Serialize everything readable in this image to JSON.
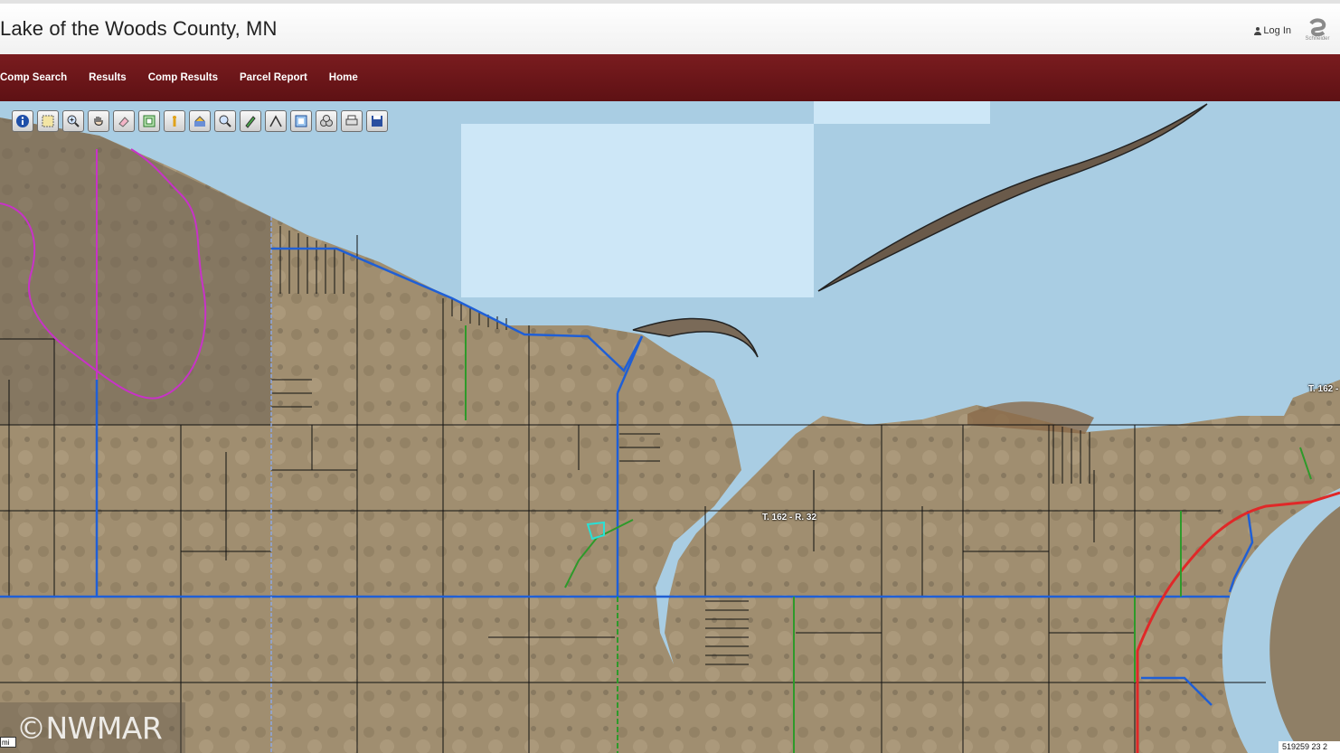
{
  "header": {
    "title": "Lake of the Woods County, MN",
    "login_label": "Log In",
    "brand_text": "Schneider"
  },
  "nav": {
    "items": [
      "Comp Search",
      "Results",
      "Comp Results",
      "Parcel Report",
      "Home"
    ]
  },
  "toolbar": {
    "tools": [
      "info-icon",
      "select-area-icon",
      "zoom-in-icon",
      "pan-hand-icon",
      "eraser-icon",
      "zoom-extent-icon",
      "street-view-icon",
      "buffer-icon",
      "zoom-out-icon",
      "draw-pencil-icon",
      "measure-icon",
      "print-map-icon",
      "layers-icon",
      "print-icon",
      "save-icon"
    ]
  },
  "map": {
    "labels": {
      "township_center": "T. 162 - R. 32",
      "township_right": "T. 162 -"
    },
    "copyright": "©NWMAR",
    "scale_unit": "mi",
    "coordinates": "519259 23 2"
  },
  "colors": {
    "nav_bg": "#6b1619",
    "water": "#a9cde3",
    "land": "#9c8a6c",
    "parcel_line": "#111111",
    "road_blue": "#1f5fd6",
    "road_red": "#e02828",
    "road_green": "#2e9a2a",
    "boundary_magenta": "#c832c8"
  }
}
